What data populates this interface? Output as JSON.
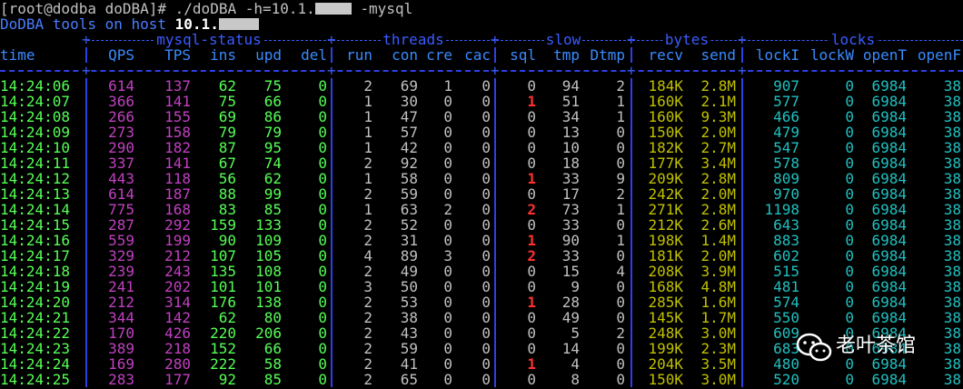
{
  "terminal": {
    "prompt": "[root@dodba doDBA]# ",
    "command_prefix": "./doDBA -h=10.1.",
    "command_suffix": " -mysql",
    "host_label": "DoDBA tools on host ",
    "host_ip_prefix": "10.1.",
    "host_ip_tail": ""
  },
  "groups": {
    "mysql_status": "mysql-status",
    "threads": "threads",
    "slow": "slow",
    "bytes": "bytes",
    "locks": "locks"
  },
  "columns": {
    "time": "time",
    "qps": "QPS",
    "tps": "TPS",
    "ins": "ins",
    "upd": "upd",
    "del": "del",
    "run": "run",
    "con": "con",
    "cre": "cre",
    "cac": "cac",
    "sql": "sql",
    "tmp": "tmp",
    "dtmp": "Dtmp",
    "recv": "recv",
    "send": "send",
    "locki": "lockI",
    "lockw": "lockW",
    "opent": "openT",
    "openf": "openF"
  },
  "colors": {
    "background": "#000000",
    "time": "#55ff55",
    "qps_tps": "#c040c0",
    "dml": "#55ff55",
    "bytes": "#c0c000",
    "locks": "#20c0c0",
    "slow_highlight": "#ff3030",
    "separator": "#2f3fe6"
  },
  "rows": [
    {
      "time": "14:24:06",
      "qps": "614",
      "tps": "137",
      "ins": "62",
      "upd": "75",
      "del": "0",
      "run": "2",
      "con": "69",
      "cre": "1",
      "cac": "0",
      "sql": "0",
      "tmp": "94",
      "dtmp": "2",
      "recv": "184K",
      "send": "2.8M",
      "locki": "907",
      "lockw": "0",
      "opent": "6984",
      "openf": "38"
    },
    {
      "time": "14:24:07",
      "qps": "366",
      "tps": "141",
      "ins": "75",
      "upd": "66",
      "del": "0",
      "run": "1",
      "con": "30",
      "cre": "0",
      "cac": "0",
      "sql": "1",
      "tmp": "51",
      "dtmp": "1",
      "recv": "160K",
      "send": "2.1M",
      "locki": "577",
      "lockw": "0",
      "opent": "6984",
      "openf": "38"
    },
    {
      "time": "14:24:08",
      "qps": "266",
      "tps": "155",
      "ins": "69",
      "upd": "86",
      "del": "0",
      "run": "1",
      "con": "47",
      "cre": "0",
      "cac": "0",
      "sql": "0",
      "tmp": "34",
      "dtmp": "1",
      "recv": "160K",
      "send": "9.3M",
      "locki": "466",
      "lockw": "0",
      "opent": "6984",
      "openf": "38"
    },
    {
      "time": "14:24:09",
      "qps": "273",
      "tps": "158",
      "ins": "79",
      "upd": "79",
      "del": "0",
      "run": "1",
      "con": "57",
      "cre": "0",
      "cac": "0",
      "sql": "0",
      "tmp": "13",
      "dtmp": "0",
      "recv": "150K",
      "send": "2.0M",
      "locki": "479",
      "lockw": "0",
      "opent": "6984",
      "openf": "38"
    },
    {
      "time": "14:24:10",
      "qps": "290",
      "tps": "182",
      "ins": "87",
      "upd": "95",
      "del": "0",
      "run": "1",
      "con": "42",
      "cre": "0",
      "cac": "0",
      "sql": "0",
      "tmp": "10",
      "dtmp": "0",
      "recv": "182K",
      "send": "2.7M",
      "locki": "547",
      "lockw": "0",
      "opent": "6984",
      "openf": "38"
    },
    {
      "time": "14:24:11",
      "qps": "337",
      "tps": "141",
      "ins": "67",
      "upd": "74",
      "del": "0",
      "run": "2",
      "con": "92",
      "cre": "0",
      "cac": "0",
      "sql": "0",
      "tmp": "18",
      "dtmp": "0",
      "recv": "177K",
      "send": "3.4M",
      "locki": "578",
      "lockw": "0",
      "opent": "6984",
      "openf": "38"
    },
    {
      "time": "14:24:12",
      "qps": "443",
      "tps": "118",
      "ins": "56",
      "upd": "62",
      "del": "0",
      "run": "1",
      "con": "58",
      "cre": "0",
      "cac": "0",
      "sql": "1",
      "tmp": "33",
      "dtmp": "9",
      "recv": "209K",
      "send": "2.8M",
      "locki": "809",
      "lockw": "0",
      "opent": "6984",
      "openf": "38"
    },
    {
      "time": "14:24:13",
      "qps": "614",
      "tps": "187",
      "ins": "88",
      "upd": "99",
      "del": "0",
      "run": "2",
      "con": "59",
      "cre": "0",
      "cac": "0",
      "sql": "0",
      "tmp": "17",
      "dtmp": "2",
      "recv": "242K",
      "send": "2.0M",
      "locki": "970",
      "lockw": "0",
      "opent": "6984",
      "openf": "38"
    },
    {
      "time": "14:24:14",
      "qps": "775",
      "tps": "168",
      "ins": "83",
      "upd": "85",
      "del": "0",
      "run": "1",
      "con": "63",
      "cre": "2",
      "cac": "0",
      "sql": "2",
      "tmp": "73",
      "dtmp": "1",
      "recv": "271K",
      "send": "2.8M",
      "locki": "1198",
      "lockw": "0",
      "opent": "6984",
      "openf": "38"
    },
    {
      "time": "14:24:15",
      "qps": "287",
      "tps": "292",
      "ins": "159",
      "upd": "133",
      "del": "0",
      "run": "2",
      "con": "52",
      "cre": "0",
      "cac": "0",
      "sql": "0",
      "tmp": "33",
      "dtmp": "0",
      "recv": "212K",
      "send": "2.6M",
      "locki": "643",
      "lockw": "0",
      "opent": "6984",
      "openf": "38"
    },
    {
      "time": "14:24:16",
      "qps": "559",
      "tps": "199",
      "ins": "90",
      "upd": "109",
      "del": "0",
      "run": "2",
      "con": "31",
      "cre": "0",
      "cac": "0",
      "sql": "1",
      "tmp": "90",
      "dtmp": "1",
      "recv": "198K",
      "send": "1.4M",
      "locki": "883",
      "lockw": "0",
      "opent": "6984",
      "openf": "38"
    },
    {
      "time": "14:24:17",
      "qps": "329",
      "tps": "212",
      "ins": "107",
      "upd": "105",
      "del": "0",
      "run": "4",
      "con": "89",
      "cre": "3",
      "cac": "0",
      "sql": "2",
      "tmp": "33",
      "dtmp": "0",
      "recv": "181K",
      "send": "2.0M",
      "locki": "602",
      "lockw": "0",
      "opent": "6984",
      "openf": "38"
    },
    {
      "time": "14:24:18",
      "qps": "239",
      "tps": "243",
      "ins": "135",
      "upd": "108",
      "del": "0",
      "run": "2",
      "con": "49",
      "cre": "0",
      "cac": "0",
      "sql": "0",
      "tmp": "15",
      "dtmp": "4",
      "recv": "208K",
      "send": "3.9M",
      "locki": "515",
      "lockw": "0",
      "opent": "6984",
      "openf": "38"
    },
    {
      "time": "14:24:19",
      "qps": "241",
      "tps": "202",
      "ins": "101",
      "upd": "101",
      "del": "0",
      "run": "3",
      "con": "50",
      "cre": "0",
      "cac": "0",
      "sql": "0",
      "tmp": "9",
      "dtmp": "0",
      "recv": "168K",
      "send": "4.8M",
      "locki": "481",
      "lockw": "0",
      "opent": "6984",
      "openf": "38"
    },
    {
      "time": "14:24:20",
      "qps": "212",
      "tps": "314",
      "ins": "176",
      "upd": "138",
      "del": "0",
      "run": "2",
      "con": "53",
      "cre": "0",
      "cac": "0",
      "sql": "1",
      "tmp": "28",
      "dtmp": "0",
      "recv": "285K",
      "send": "1.6M",
      "locki": "574",
      "lockw": "0",
      "opent": "6984",
      "openf": "38"
    },
    {
      "time": "14:24:21",
      "qps": "344",
      "tps": "142",
      "ins": "62",
      "upd": "80",
      "del": "0",
      "run": "2",
      "con": "38",
      "cre": "0",
      "cac": "0",
      "sql": "0",
      "tmp": "49",
      "dtmp": "0",
      "recv": "145K",
      "send": "1.7M",
      "locki": "550",
      "lockw": "0",
      "opent": "6984",
      "openf": "38"
    },
    {
      "time": "14:24:22",
      "qps": "170",
      "tps": "426",
      "ins": "220",
      "upd": "206",
      "del": "0",
      "run": "2",
      "con": "43",
      "cre": "0",
      "cac": "0",
      "sql": "0",
      "tmp": "5",
      "dtmp": "2",
      "recv": "248K",
      "send": "3.0M",
      "locki": "609",
      "lockw": "0",
      "opent": "6984",
      "openf": "38"
    },
    {
      "time": "14:24:23",
      "qps": "389",
      "tps": "218",
      "ins": "152",
      "upd": "66",
      "del": "0",
      "run": "2",
      "con": "59",
      "cre": "0",
      "cac": "0",
      "sql": "0",
      "tmp": "14",
      "dtmp": "0",
      "recv": "199K",
      "send": "2.3M",
      "locki": "683",
      "lockw": "0",
      "opent": "6984",
      "openf": "38"
    },
    {
      "time": "14:24:24",
      "qps": "169",
      "tps": "280",
      "ins": "222",
      "upd": "58",
      "del": "0",
      "run": "2",
      "con": "41",
      "cre": "0",
      "cac": "0",
      "sql": "1",
      "tmp": "4",
      "dtmp": "0",
      "recv": "204K",
      "send": "3.5M",
      "locki": "480",
      "lockw": "0",
      "opent": "6984",
      "openf": "38"
    },
    {
      "time": "14:24:25",
      "qps": "283",
      "tps": "177",
      "ins": "92",
      "upd": "85",
      "del": "0",
      "run": "2",
      "con": "65",
      "cre": "0",
      "cac": "0",
      "sql": "0",
      "tmp": "8",
      "dtmp": "0",
      "recv": "150K",
      "send": "3.0M",
      "locki": "520",
      "lockw": "0",
      "opent": "6984",
      "openf": "38"
    }
  ],
  "watermark": {
    "icon": "wechat-icon",
    "text": "老叶茶馆"
  }
}
